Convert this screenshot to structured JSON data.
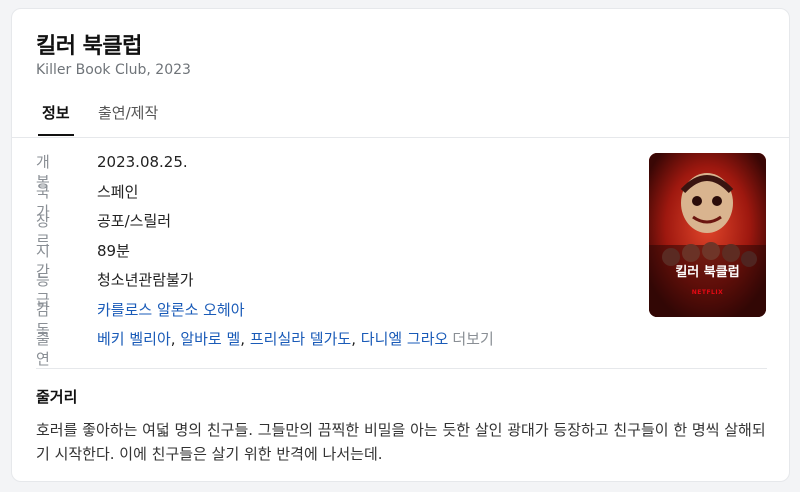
{
  "movie": {
    "title": "킬러 북클럽",
    "subtitle": "Killer Book Club, 2023"
  },
  "tabs": [
    {
      "label": "정보",
      "active": true
    },
    {
      "label": "출연/제작",
      "active": false
    }
  ],
  "info": {
    "release": {
      "label": "개봉",
      "value": "2023.08.25."
    },
    "country": {
      "label": "국가",
      "value": "스페인"
    },
    "genre": {
      "label": "장르",
      "value": "공포/스릴러"
    },
    "runtime": {
      "label": "시간",
      "value": "89분"
    },
    "rating": {
      "label": "등급",
      "value": "청소년관람불가"
    },
    "director": {
      "label": "감독",
      "value": "카를로스 알론소 오헤아"
    },
    "cast": {
      "label": "출연",
      "members": [
        "베키 벨리아",
        "알바로 멜",
        "프리실라 델가도",
        "다니엘 그라오"
      ],
      "more": "더보기"
    }
  },
  "poster": {
    "title_text": "킬러 북클럽",
    "brand": "NETFLIX"
  },
  "synopsis": {
    "heading": "줄거리",
    "text": "호러를 좋아하는 여덟 명의 친구들. 그들만의 끔찍한 비밀을 아는 듯한 살인 광대가 등장하고 친구들이 한 명씩 살해되기 시작한다. 이에 친구들은 살기 위한 반격에 나서는데."
  },
  "colors": {
    "link": "#1a5bb8",
    "label": "#8a8f95",
    "poster_red": "#b52016"
  }
}
